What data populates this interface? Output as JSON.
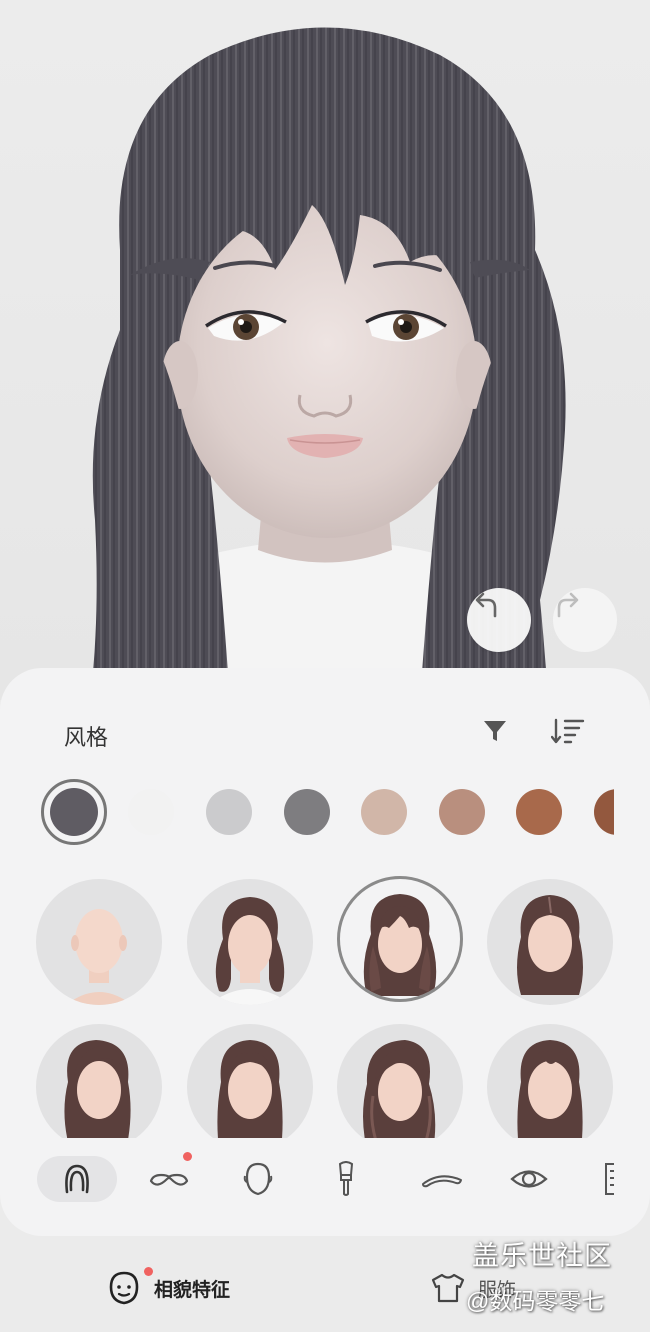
{
  "panel": {
    "title": "风格"
  },
  "hair_colors": [
    {
      "name": "dark-gray",
      "hex": "#5f5c63",
      "selected": true
    },
    {
      "name": "white",
      "hex": "#f2f2f2"
    },
    {
      "name": "light-gray",
      "hex": "#cbcbcd"
    },
    {
      "name": "gray",
      "hex": "#7e7d80"
    },
    {
      "name": "beige",
      "hex": "#d1b6a8"
    },
    {
      "name": "tan",
      "hex": "#b98f7e"
    },
    {
      "name": "brown",
      "hex": "#a8694b"
    },
    {
      "name": "dark-brown",
      "hex": "#93583e"
    }
  ],
  "hair_styles": [
    {
      "name": "bald"
    },
    {
      "name": "half-up-tied"
    },
    {
      "name": "long-with-bangs",
      "selected": true
    },
    {
      "name": "long-straight-part"
    },
    {
      "name": "long-side-swept"
    },
    {
      "name": "long-straight"
    },
    {
      "name": "wavy-side-part"
    },
    {
      "name": "long-layered"
    }
  ],
  "categories": [
    {
      "icon": "hair-icon",
      "active": true
    },
    {
      "icon": "mustache-icon",
      "badge": true
    },
    {
      "icon": "face-shape-icon"
    },
    {
      "icon": "makeup-brush-icon"
    },
    {
      "icon": "eyebrow-icon"
    },
    {
      "icon": "eye-icon"
    },
    {
      "icon": "more-icon"
    }
  ],
  "bottom_tabs": [
    {
      "label": "相貌特征",
      "icon": "face-features-icon",
      "active": true,
      "badge": true
    },
    {
      "label": "服饰",
      "icon": "clothing-icon"
    }
  ],
  "watermark": {
    "line1": "盖乐世社区",
    "line2": "@数码零零七"
  },
  "colors": {
    "panel_bg": "#f3f3f4",
    "badge": "#f06260",
    "hair": "#4e4c55",
    "skin": "#e3d5d2"
  }
}
